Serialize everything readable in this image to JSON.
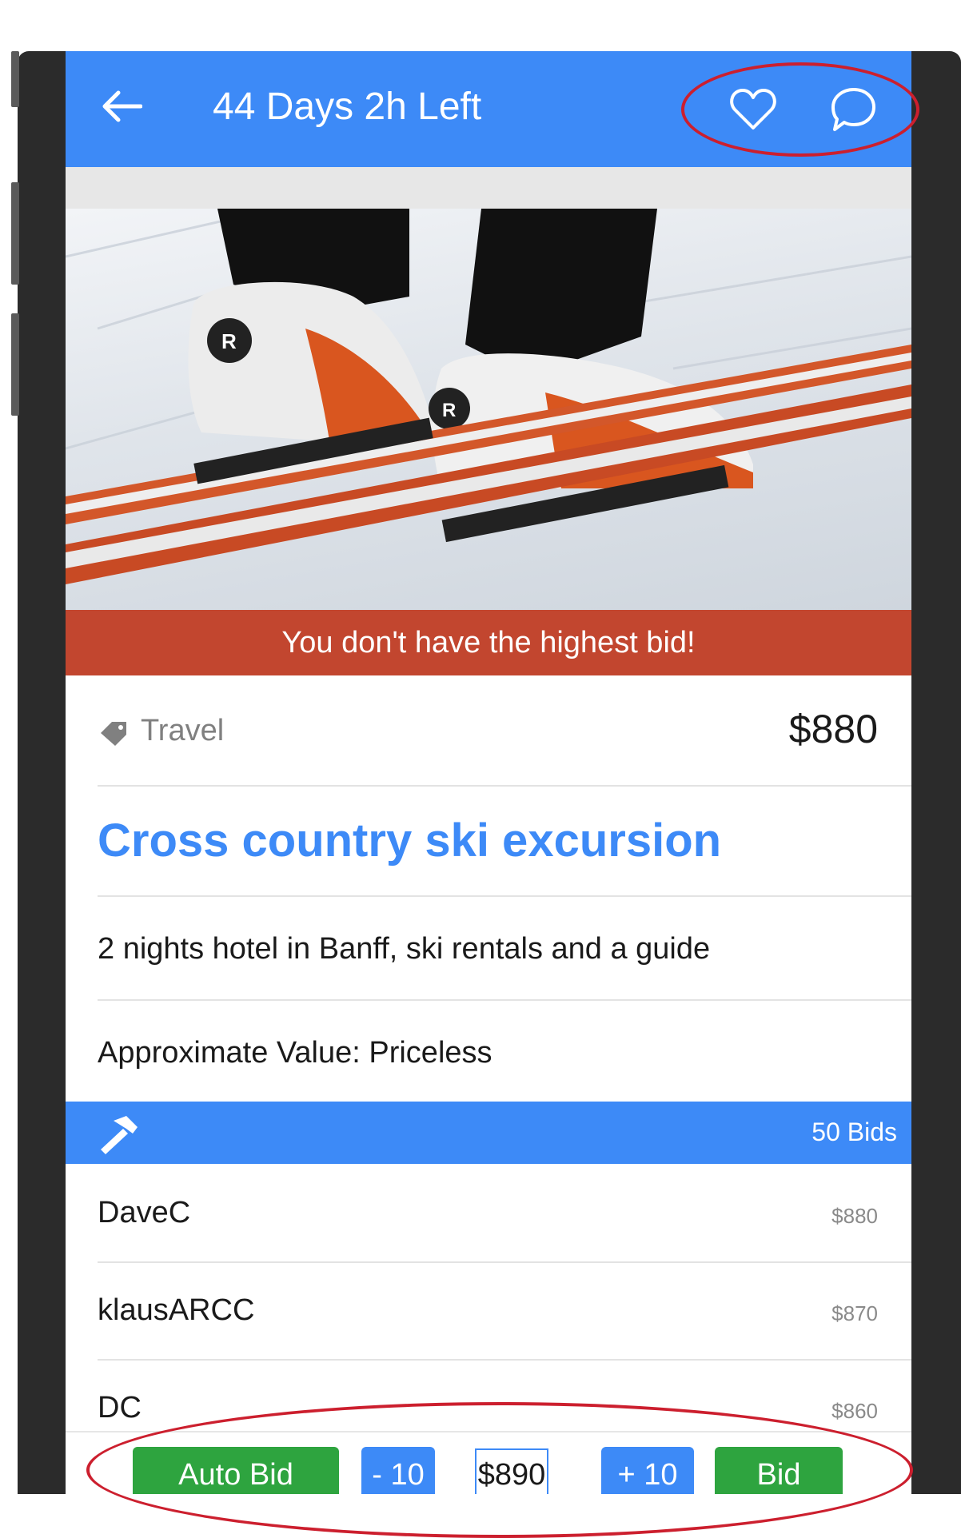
{
  "header": {
    "back_icon": "back-arrow-icon",
    "title": "44 Days 2h Left",
    "favorite_icon": "heart-icon",
    "chat_icon": "chat-bubble-icon"
  },
  "item": {
    "image_alt": "Cross country ski boots on skis in snow",
    "alert": "You don't have the highest bid!",
    "category_icon": "tag-icon",
    "category": "Travel",
    "current_price": "$880",
    "title": "Cross country ski excursion",
    "description": "2 nights hotel in Banff, ski rentals and a guide",
    "approximate_value": "Approximate Value: Priceless"
  },
  "bids": {
    "icon": "hammer-icon",
    "count_label": "50 Bids",
    "list": [
      {
        "name": "DaveC",
        "amount": "$880"
      },
      {
        "name": "klausARCC",
        "amount": "$870"
      },
      {
        "name": "DC",
        "amount": "$860"
      }
    ]
  },
  "actions": {
    "auto_bid": "Auto Bid",
    "decrement": "- 10",
    "bid_value": "$890",
    "increment": "+ 10",
    "bid": "Bid"
  },
  "colors": {
    "primary_blue": "#3d8af7",
    "alert_red": "#c2462f",
    "action_green": "#2ea43f",
    "annotation_red": "#cc1f2e"
  }
}
